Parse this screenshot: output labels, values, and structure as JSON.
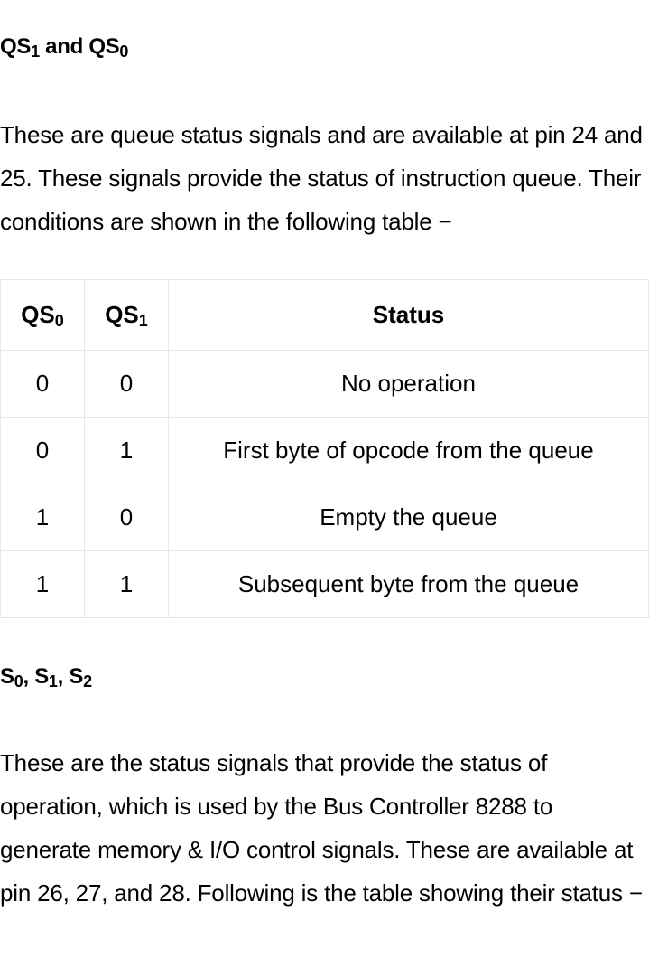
{
  "section1": {
    "heading": {
      "a_base": "QS",
      "a_sub": "1",
      "mid": " and ",
      "b_base": "QS",
      "b_sub": "0"
    },
    "paragraph": "These are queue status signals and are available at pin 24 and 25. These signals provide the status of instruction queue. Their conditions are shown in the following table −"
  },
  "table": {
    "headers": [
      {
        "base": "QS",
        "sub": "0"
      },
      {
        "base": "QS",
        "sub": "1"
      },
      {
        "base": "Status",
        "sub": ""
      }
    ],
    "rows": [
      [
        "0",
        "0",
        "No operation"
      ],
      [
        "0",
        "1",
        "First byte of opcode from the queue"
      ],
      [
        "1",
        "0",
        "Empty the queue"
      ],
      [
        "1",
        "1",
        "Subsequent byte from the queue"
      ]
    ]
  },
  "section2": {
    "heading": {
      "s0_base": "S",
      "s0_sub": "0",
      "s1_base": "S",
      "s1_sub": "1",
      "s2_base": "S",
      "s2_sub": "2",
      "sep": ", "
    },
    "paragraph": "These are the status signals that provide the status of operation, which is used by the Bus Controller 8288 to generate memory & I/O control signals. These are available at pin 26, 27, and 28. Following is the table showing their status −"
  }
}
